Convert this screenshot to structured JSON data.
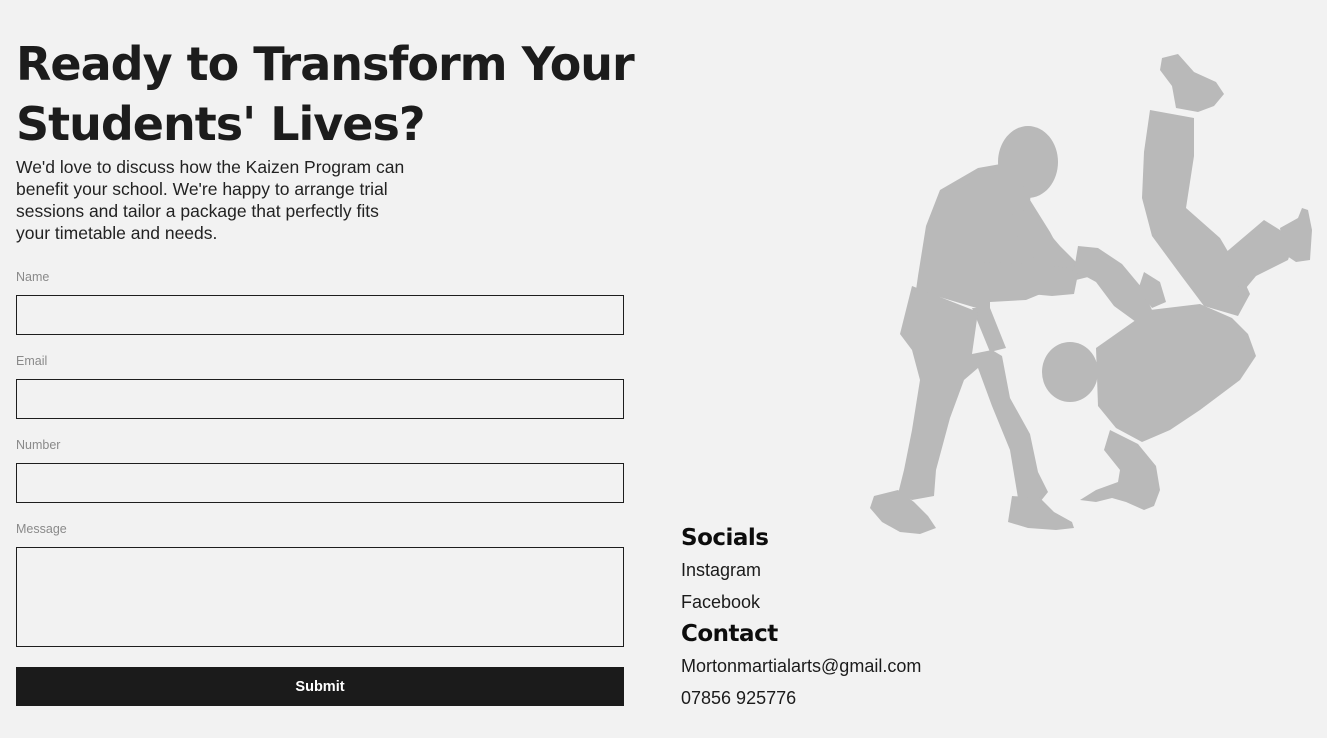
{
  "hero": {
    "title": "Ready to Transform Your Students' Lives?",
    "intro": "We'd love to discuss how the Kaizen Program can benefit your school. We're happy to arrange trial sessions and tailor a package that perfectly fits your timetable and needs."
  },
  "form": {
    "name_label": "Name",
    "name_value": "",
    "email_label": "Email",
    "email_value": "",
    "number_label": "Number",
    "number_value": "",
    "message_label": "Message",
    "message_value": "",
    "submit_label": "Submit"
  },
  "illustration": {
    "icon": "judo-throw-silhouette",
    "color": "#b9b9b9"
  },
  "socials": {
    "heading": "Socials",
    "items": [
      "Instagram",
      "Facebook"
    ]
  },
  "contact": {
    "heading": "Contact",
    "email": "Mortonmartialarts@gmail.com",
    "phone": "07856 925776"
  },
  "colors": {
    "background": "#f2f2f2",
    "text": "#1b1b1b",
    "button": "#1b1b1b",
    "label": "#8a8a8a"
  }
}
